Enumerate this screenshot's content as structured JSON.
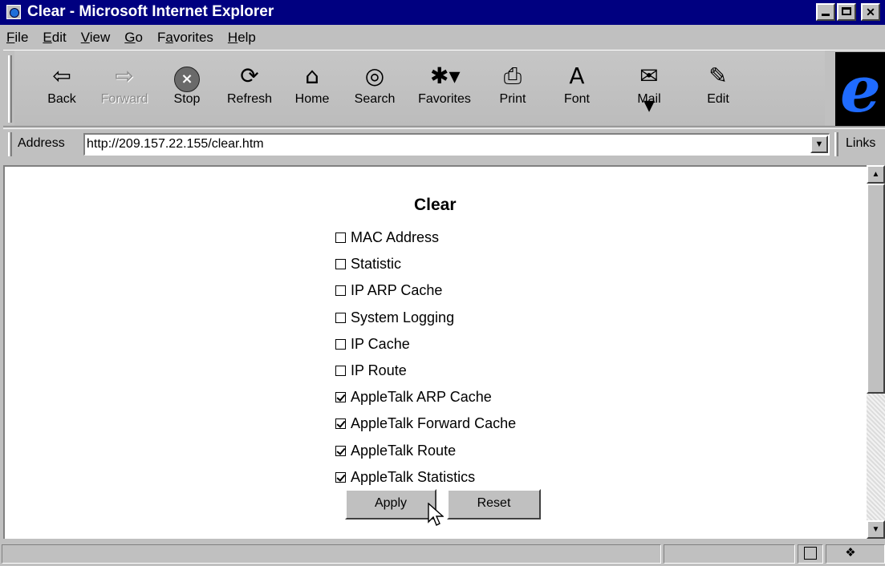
{
  "window": {
    "title": "Clear - Microsoft Internet Explorer",
    "controls": {
      "minimize": "minimize",
      "maximize": "maximize",
      "close": "✕"
    }
  },
  "menu": [
    {
      "label": "File",
      "accel": "F",
      "rest": "ile"
    },
    {
      "label": "Edit",
      "accel": "E",
      "rest": "dit"
    },
    {
      "label": "View",
      "accel": "V",
      "rest": "iew"
    },
    {
      "label": "Go",
      "accel": "G",
      "rest": "o"
    },
    {
      "label": "Favorites",
      "accel": "a",
      "pre": "F",
      "rest": "vorites"
    },
    {
      "label": "Help",
      "accel": "H",
      "rest": "elp"
    }
  ],
  "toolbar": {
    "back": {
      "label": "Back",
      "icon": "⇦"
    },
    "forward": {
      "label": "Forward",
      "icon": "⇨"
    },
    "stop": {
      "label": "Stop",
      "icon": "×"
    },
    "refresh": {
      "label": "Refresh",
      "icon": "⟳"
    },
    "home": {
      "label": "Home",
      "icon": "⌂"
    },
    "search": {
      "label": "Search",
      "icon": "◎"
    },
    "favorites": {
      "label": "Favorites",
      "icon": "✱▾"
    },
    "print": {
      "label": "Print",
      "icon": "⎙"
    },
    "font": {
      "label": "Font",
      "icon": "A"
    },
    "mail": {
      "label": "Mail",
      "icon": "✉▾"
    },
    "edit": {
      "label": "Edit",
      "icon": "✎"
    }
  },
  "address": {
    "label": "Address",
    "url": "http://209.157.22.155/clear.htm",
    "links_label": "Links"
  },
  "page": {
    "title": "Clear",
    "options": [
      {
        "label": "MAC Address",
        "checked": false
      },
      {
        "label": "Statistic",
        "checked": false
      },
      {
        "label": "IP ARP Cache",
        "checked": false
      },
      {
        "label": "System Logging",
        "checked": false
      },
      {
        "label": "IP Cache",
        "checked": false
      },
      {
        "label": "IP Route",
        "checked": false
      },
      {
        "label": "AppleTalk ARP Cache",
        "checked": true
      },
      {
        "label": "AppleTalk Forward Cache",
        "checked": true
      },
      {
        "label": "AppleTalk Route",
        "checked": true
      },
      {
        "label": "AppleTalk Statistics",
        "checked": true
      }
    ],
    "apply_label": "Apply",
    "reset_label": "Reset"
  },
  "colors": {
    "titlebar": "#000080",
    "chrome": "#c0c0c0"
  }
}
